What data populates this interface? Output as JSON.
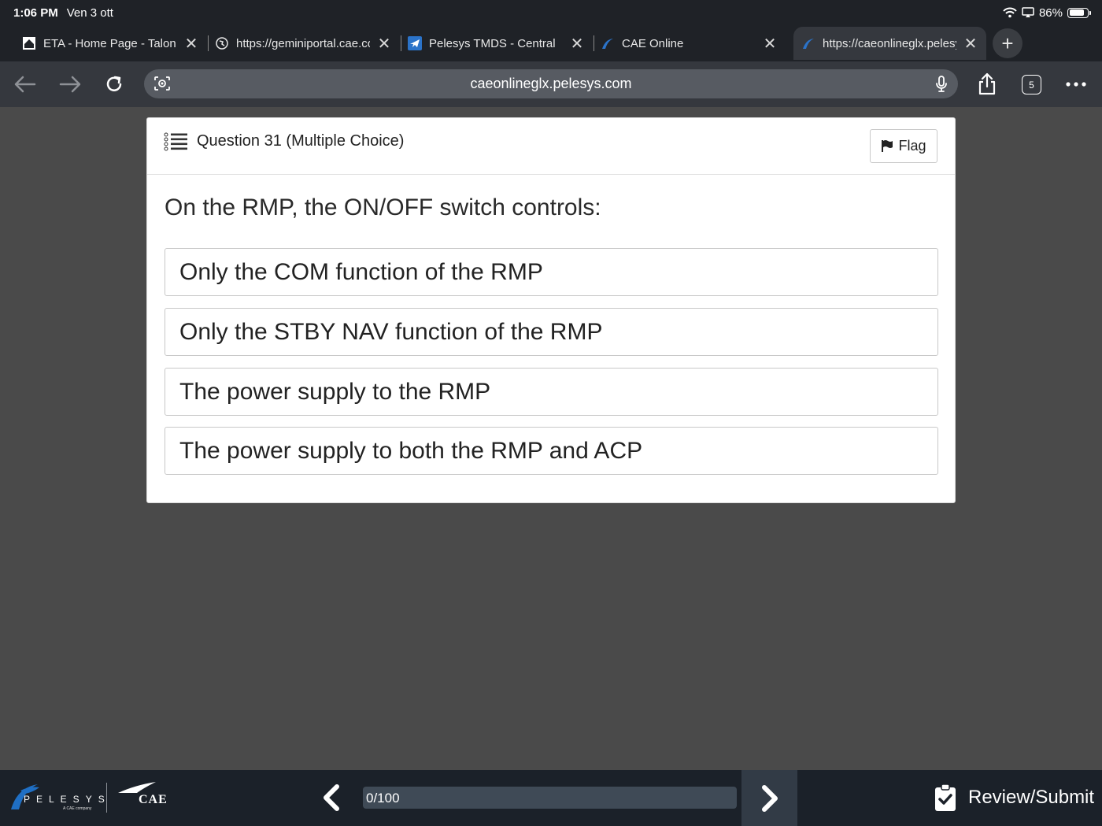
{
  "status": {
    "time": "1:06 PM",
    "date": "Ven 3 ott",
    "battery": "86%"
  },
  "tabs": [
    {
      "title": "ETA - Home Page - Talon",
      "icon": "home-icon"
    },
    {
      "title": "https://geminiportal.cae.com",
      "icon": "globe-icon"
    },
    {
      "title": "Pelesys TMDS - Central",
      "icon": "plane-icon"
    },
    {
      "title": "CAE Online",
      "icon": "pelesys-icon"
    },
    {
      "title": "https://caeonlineglx.pelesys.com",
      "icon": "pelesys-icon",
      "active": true
    }
  ],
  "address": {
    "url": "caeonlineglx.pelesys.com",
    "tab_count": "5"
  },
  "question": {
    "title": "Question 31 (Multiple Choice)",
    "flag_label": "Flag",
    "text": "On the RMP, the ON/OFF switch controls:",
    "options": [
      "Only the COM function of the RMP",
      "Only the STBY NAV function of the RMP",
      "The power supply to the RMP",
      "The power supply to both the RMP and ACP"
    ]
  },
  "footer": {
    "brand": "PELESYS",
    "brand_sub": "A CAE company",
    "partner": "CAE",
    "progress_text": "0/100",
    "progress_value": 0,
    "review_label": "Review/Submit"
  },
  "colors": {
    "accent": "#1f6fc4",
    "bottom_bar": "#1b2129",
    "page_bg": "#4a4a4a"
  }
}
